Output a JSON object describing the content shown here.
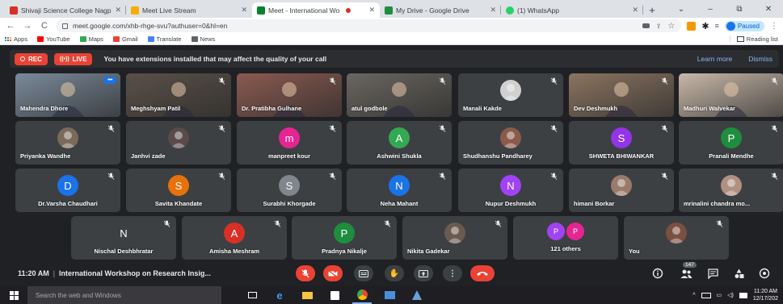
{
  "browser": {
    "tabs": [
      {
        "label": "Shivaji Science College Nagp",
        "favicon_color": "#d93025",
        "active": false
      },
      {
        "label": "Meet Live Stream",
        "favicon_color": "#f9ab00",
        "active": false
      },
      {
        "label": "Meet - International Wo",
        "favicon_color": "#00832d",
        "active": true
      },
      {
        "label": "My Drive - Google Drive",
        "favicon_color": "#1e8e3e",
        "active": false
      },
      {
        "label": "(1) WhatsApp",
        "favicon_color": "#25d366",
        "active": false
      }
    ],
    "new_tab": "+",
    "window_controls": {
      "minimize": "–",
      "maximize": "⧉",
      "close": "✕"
    },
    "url": "meet.google.com/xhb-rhge-svu?authuser=0&hl=en",
    "nav": {
      "back": "←",
      "forward": "→",
      "reload": "C"
    },
    "profile_status": "Paused",
    "profile_initial": "",
    "bookmarks": [
      {
        "label": "Apps",
        "color": "#1a73e8"
      },
      {
        "label": "YouTube",
        "color": "#ff0000"
      },
      {
        "label": "Maps",
        "color": "#34a853"
      },
      {
        "label": "Gmail",
        "color": "#ea4335"
      },
      {
        "label": "Translate",
        "color": "#4285f4"
      },
      {
        "label": "News",
        "color": "#5f6368"
      }
    ],
    "reading_list": "Reading list"
  },
  "banner": {
    "rec_label": "REC",
    "live_label": "LIVE",
    "message": "You have extensions installed that may affect the quality of your call",
    "learn_more": "Learn more",
    "dismiss": "Dismiss"
  },
  "participants": [
    {
      "name": "Mahendra Dhore",
      "kind": "camera",
      "bg": "#7a8a9a",
      "pinned": true
    },
    {
      "name": "Meghshyam Patil",
      "kind": "camera",
      "bg": "#5a5048"
    },
    {
      "name": "Dr. Pratibha Gulhane",
      "kind": "camera",
      "bg": "#8a5a50"
    },
    {
      "name": "atul godbole",
      "kind": "camera",
      "bg": "#6a6660"
    },
    {
      "name": "Manali Kakde",
      "kind": "photo",
      "bg": "#3c4043",
      "photo_color": "#d0d0d0"
    },
    {
      "name": "Dev Deshmukh",
      "kind": "camera",
      "bg": "#8a7460"
    },
    {
      "name": "Madhuri Walvekar",
      "kind": "camera",
      "bg": "#c8b8a8"
    },
    {
      "name": "Priyanka Wandhe",
      "kind": "photo",
      "photo_color": "#7a6a5a"
    },
    {
      "name": "Janhvi zade",
      "kind": "photo",
      "photo_color": "#5a4a4a"
    },
    {
      "name": "manpreet kour",
      "kind": "avatar",
      "initial": "m",
      "color": "#e52592"
    },
    {
      "name": "Ashwini Shukla",
      "kind": "avatar",
      "initial": "A",
      "color": "#34a853"
    },
    {
      "name": "Shudhanshu Pandharey",
      "kind": "photo",
      "photo_color": "#8a5a4a"
    },
    {
      "name": "SHWETA BHIWANKAR",
      "kind": "avatar",
      "initial": "S",
      "color": "#9334e6"
    },
    {
      "name": "Pranali Mendhe",
      "kind": "avatar",
      "initial": "P",
      "color": "#1e8e3e"
    },
    {
      "name": "Dr.Varsha Chaudhari",
      "kind": "avatar",
      "initial": "D",
      "color": "#1a73e8"
    },
    {
      "name": "Savita Khandate",
      "kind": "avatar",
      "initial": "S",
      "color": "#e8710a"
    },
    {
      "name": "Surabhi Khorgade",
      "kind": "avatar",
      "initial": "S",
      "color": "#80868b"
    },
    {
      "name": "Neha Mahant",
      "kind": "avatar",
      "initial": "N",
      "color": "#1a73e8"
    },
    {
      "name": "Nupur Deshmukh",
      "kind": "avatar",
      "initial": "N",
      "color": "#a142f4"
    },
    {
      "name": "himani Borkar",
      "kind": "photo",
      "photo_color": "#9a7a6a"
    },
    {
      "name": "mrinalini chandra mo...",
      "kind": "photo",
      "photo_color": "#b09080"
    },
    {
      "name": "Nischal Deshbhratar",
      "kind": "avatar",
      "initial": "N",
      "color": "#3c4043"
    },
    {
      "name": "Amisha Meshram",
      "kind": "avatar",
      "initial": "A",
      "color": "#d93025"
    },
    {
      "name": "Pradnya Nikalje",
      "kind": "avatar",
      "initial": "P",
      "color": "#1e8e3e"
    },
    {
      "name": "Nikita Gadekar",
      "kind": "photo",
      "photo_color": "#6a5a50"
    },
    {
      "name": "121 others",
      "kind": "others",
      "initials": [
        "P",
        "P"
      ]
    },
    {
      "name": "You",
      "kind": "photo",
      "photo_color": "#7a5040"
    }
  ],
  "callbar": {
    "time": "11:20 AM",
    "separator": "|",
    "meeting_title": "International Workshop on Research Insig...",
    "participant_count": "147"
  },
  "taskbar": {
    "search_placeholder": "Search the web and Windows",
    "clock_time": "11:20 AM",
    "clock_date": "12/17/202"
  },
  "colors": {
    "meet_bg": "#202124",
    "tile_bg": "#3c4043",
    "red": "#ea4335",
    "accent_blue": "#8ab4f8"
  }
}
